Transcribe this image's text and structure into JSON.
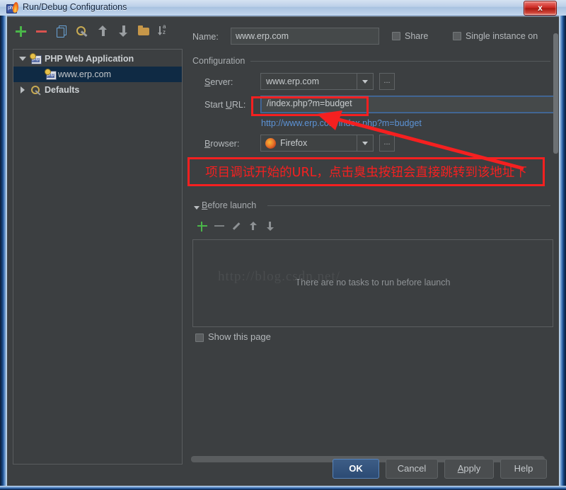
{
  "window": {
    "title": "Run/Debug Configurations",
    "app_icon": "php-flame-icon",
    "close_label": "x"
  },
  "toolbar": {
    "items": [
      {
        "name": "add-configuration",
        "icon": "plus-icon"
      },
      {
        "name": "remove-configuration",
        "icon": "minus-icon"
      },
      {
        "name": "copy-configuration",
        "icon": "copy-icon"
      },
      {
        "name": "edit-defaults",
        "icon": "wrench-icon"
      },
      {
        "name": "move-up",
        "icon": "arrow-up-icon"
      },
      {
        "name": "move-down",
        "icon": "arrow-down-icon"
      },
      {
        "name": "create-folder",
        "icon": "folder-icon"
      },
      {
        "name": "sort-configurations",
        "icon": "sort-alpha-icon"
      }
    ]
  },
  "tree": {
    "nodes": [
      {
        "label": "PHP Web Application",
        "icon": "php-web-icon",
        "expanded": true,
        "selected": false,
        "depth": 0
      },
      {
        "label": "www.erp.com",
        "icon": "php-web-icon",
        "expanded": null,
        "selected": true,
        "depth": 1
      },
      {
        "label": "Defaults",
        "icon": "wrench-icon",
        "expanded": false,
        "selected": false,
        "depth": 0
      }
    ]
  },
  "form": {
    "name_label": "Name:",
    "name_value": "www.erp.com",
    "share_label": "Share",
    "share_checked": false,
    "single_instance_label": "Single instance on",
    "single_instance_checked": false,
    "configuration_group": "Configuration",
    "server_label": "Server:",
    "server_value": "www.erp.com",
    "server_browse": "...",
    "start_url_label": "Start URL:",
    "start_url_value": "/index.php?m=budget",
    "resolved_url": "http://www.erp.com/index.php?m=budget",
    "browser_label": "Browser:",
    "browser_value": "Firefox",
    "browser_icon": "firefox-icon",
    "browser_browse": "...",
    "before_launch_group": "Before launch",
    "before_launch_expanded": true,
    "before_launch_buttons": [
      {
        "name": "add-task",
        "icon": "plus-icon"
      },
      {
        "name": "remove-task",
        "icon": "minus-icon"
      },
      {
        "name": "edit-task",
        "icon": "pencil-icon"
      },
      {
        "name": "task-move-up",
        "icon": "arrow-up-icon"
      },
      {
        "name": "task-move-down",
        "icon": "arrow-down-icon"
      }
    ],
    "task_list_empty": "There are no tasks to run before launch",
    "show_page_label": "Show this page",
    "show_page_checked": false
  },
  "watermark": "http://blog.csdn.net/",
  "annotation": {
    "text": "项目调试开始的URL，点击臭虫按钮会直接跳转到该地址下",
    "color": "#f52020"
  },
  "buttons": {
    "ok": "OK",
    "cancel": "Cancel",
    "apply": "Apply",
    "help": "Help"
  },
  "colors": {
    "dialog_bg": "#3c3f41",
    "selection_bg": "#0f2a44",
    "link": "#5c93d6",
    "accent_red": "#f52020",
    "ok_button": "#2c4b74"
  }
}
